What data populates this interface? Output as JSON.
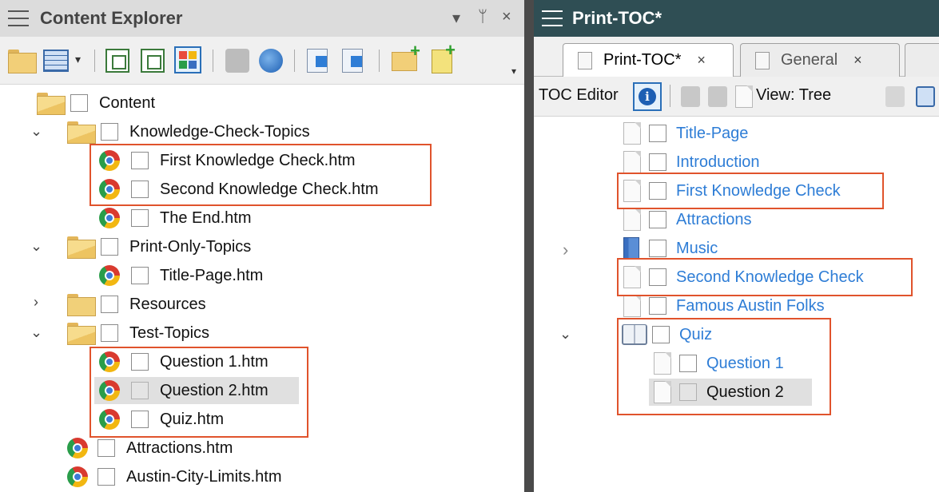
{
  "left_panel": {
    "title": "Content Explorer",
    "controls": {
      "dropdown": "▾",
      "pin": "ᛘ",
      "close": "×"
    },
    "tree": [
      {
        "label": "Content"
      },
      {
        "label": "Knowledge-Check-Topics"
      },
      {
        "label": "First Knowledge Check.htm"
      },
      {
        "label": "Second Knowledge Check.htm"
      },
      {
        "label": "The End.htm"
      },
      {
        "label": "Print-Only-Topics"
      },
      {
        "label": "Title-Page.htm"
      },
      {
        "label": "Resources"
      },
      {
        "label": "Test-Topics"
      },
      {
        "label": "Question 1.htm"
      },
      {
        "label": "Question 2.htm"
      },
      {
        "label": "Quiz.htm"
      },
      {
        "label": "Attractions.htm"
      },
      {
        "label": "Austin-City-Limits.htm"
      }
    ]
  },
  "right_panel": {
    "title": "Print-TOC*",
    "tabs": [
      {
        "label": "Print-TOC*",
        "close": "×"
      },
      {
        "label": "General",
        "close": "×"
      }
    ],
    "toolbar": {
      "editor_label": "TOC Editor",
      "info": "i",
      "view_label": "View: Tree"
    },
    "toc": [
      {
        "label": "Title-Page"
      },
      {
        "label": "Introduction"
      },
      {
        "label": "First Knowledge Check"
      },
      {
        "label": "Attractions"
      },
      {
        "label": "Music"
      },
      {
        "label": "Second Knowledge Check"
      },
      {
        "label": "Famous Austin Folks"
      },
      {
        "label": "Quiz"
      },
      {
        "label": "Question 1"
      },
      {
        "label": "Question 2"
      }
    ]
  },
  "colors": {
    "highlight_box": "#e0532c",
    "link": "#2e7dd6",
    "right_title_bg": "#2f4e54",
    "left_title_bg": "#dcdcdc"
  }
}
